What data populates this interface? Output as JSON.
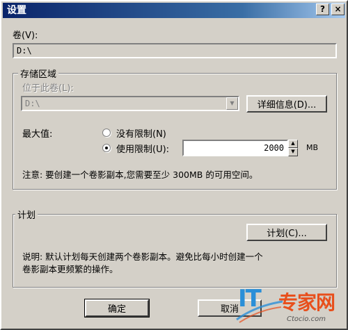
{
  "window": {
    "title": "设置",
    "help_label": "?",
    "close_label": "×"
  },
  "volume": {
    "label": "卷(V):",
    "value": "D:\\"
  },
  "storage": {
    "group_title": "存储区域",
    "location_label": "位于此卷(L):",
    "location_value": "D:\\",
    "details_button": "详细信息(D)..."
  },
  "limits": {
    "max_label": "最大值:",
    "no_limit_label": "没有限制(N)",
    "use_limit_label": "使用限制(U):",
    "use_limit_selected": true,
    "limit_value": "2000",
    "unit": "MB",
    "note": "注意: 要创建一个卷影副本,您需要至少 300MB 的可用空间。"
  },
  "schedule": {
    "group_title": "计划",
    "schedule_button": "计划(C)...",
    "description_line1": "说明: 默认计划每天创建两个卷影副本。避免比每小时创建一个",
    "description_line2": "卷影副本更频繁的操作。"
  },
  "footer": {
    "ok_button": "确定",
    "cancel_button": "取消"
  },
  "watermark": {
    "brand_it": "IT",
    "brand_cn": "专家网",
    "url": "Ctocio.com"
  },
  "colors": {
    "title_bar_start": "#0a246a",
    "title_bar_end": "#a6caf0",
    "dialog_face": "#d4d0c8",
    "watermark_blue": "#2a8fd8",
    "watermark_orange": "#e84f1c"
  }
}
